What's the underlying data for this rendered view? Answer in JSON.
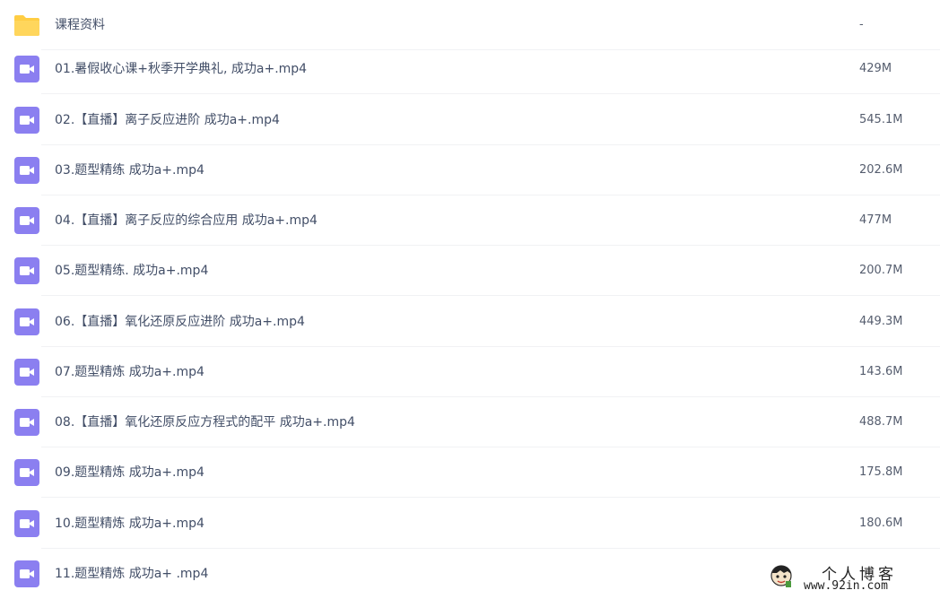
{
  "files": [
    {
      "name": "课程资料",
      "size": "-",
      "type": "folder"
    },
    {
      "name": "01.暑假收心课+秋季开学典礼, 成功a+.mp4",
      "size": "429M",
      "type": "video"
    },
    {
      "name": "02.【直播】离子反应进阶 成功a+.mp4",
      "size": "545.1M",
      "type": "video"
    },
    {
      "name": "03.题型精练 成功a+.mp4",
      "size": "202.6M",
      "type": "video"
    },
    {
      "name": "04.【直播】离子反应的综合应用 成功a+.mp4",
      "size": "477M",
      "type": "video"
    },
    {
      "name": "05.题型精练. 成功a+.mp4",
      "size": "200.7M",
      "type": "video"
    },
    {
      "name": "06.【直播】氧化还原反应进阶 成功a+.mp4",
      "size": "449.3M",
      "type": "video"
    },
    {
      "name": "07.题型精炼 成功a+.mp4",
      "size": "143.6M",
      "type": "video"
    },
    {
      "name": "08.【直播】氧化还原反应方程式的配平 成功a+.mp4",
      "size": "488.7M",
      "type": "video"
    },
    {
      "name": "09.题型精炼 成功a+.mp4",
      "size": "175.8M",
      "type": "video"
    },
    {
      "name": "10.题型精炼 成功a+.mp4",
      "size": "180.6M",
      "type": "video"
    },
    {
      "name": "11.题型精炼 成功a+ .mp4",
      "size": "",
      "type": "video"
    }
  ],
  "watermark": {
    "title": "个人博客",
    "url": "www.92in.com"
  },
  "colors": {
    "folder": "#ffcd43",
    "video": "#8b7ff0"
  }
}
